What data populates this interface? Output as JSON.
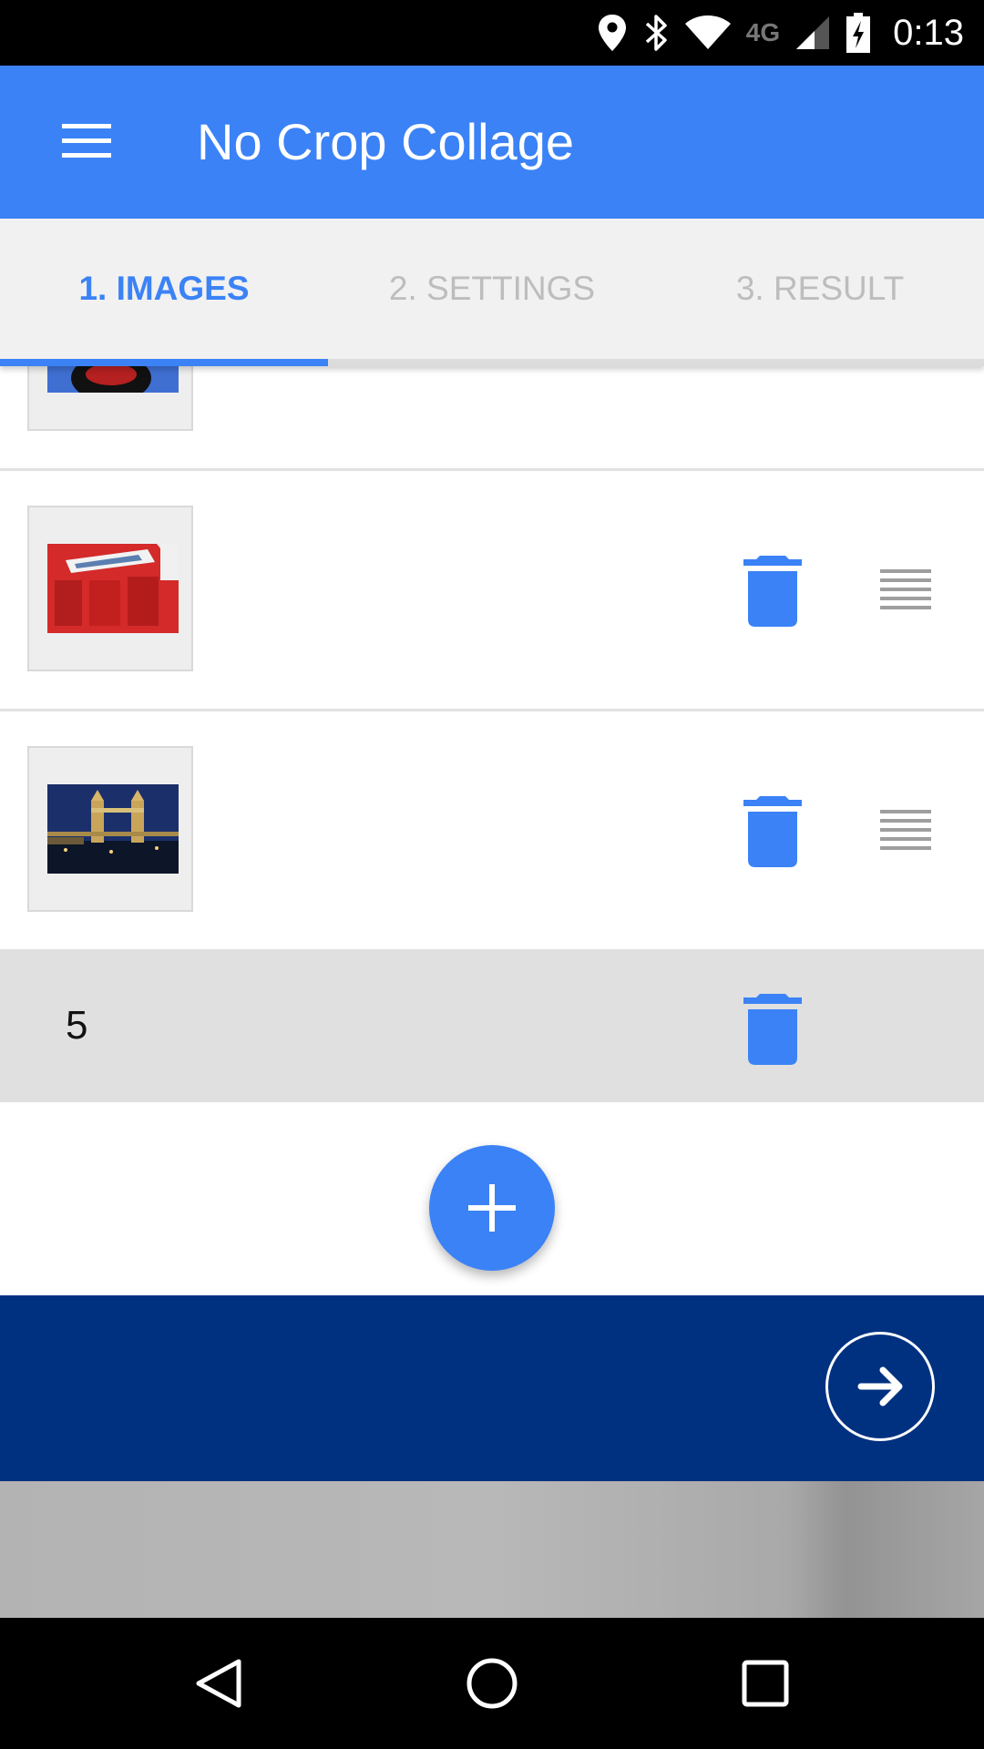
{
  "status_bar": {
    "time": "0:13",
    "network_label": "4G"
  },
  "app_bar": {
    "title": "No Crop Collage"
  },
  "tabs": [
    {
      "label": "1. IMAGES",
      "active": true
    },
    {
      "label": "2. SETTINGS",
      "active": false
    },
    {
      "label": "3. RESULT",
      "active": false
    }
  ],
  "images": [
    {
      "thumbnail": "partially-scrolled-image"
    },
    {
      "thumbnail": "red-telephone-box"
    },
    {
      "thumbnail": "tower-bridge-at-night"
    }
  ],
  "drag_placeholder": {
    "number": "5"
  },
  "icons": {
    "menu": "menu-icon",
    "delete": "trash-icon",
    "reorder": "drag-handle-icon",
    "add": "plus-icon",
    "next": "arrow-right-icon"
  },
  "colors": {
    "primary": "#3b82f6",
    "bottom_bar": "#003180",
    "placeholder": "#e0e0e0",
    "tab_inactive": "#bdbdbd"
  }
}
